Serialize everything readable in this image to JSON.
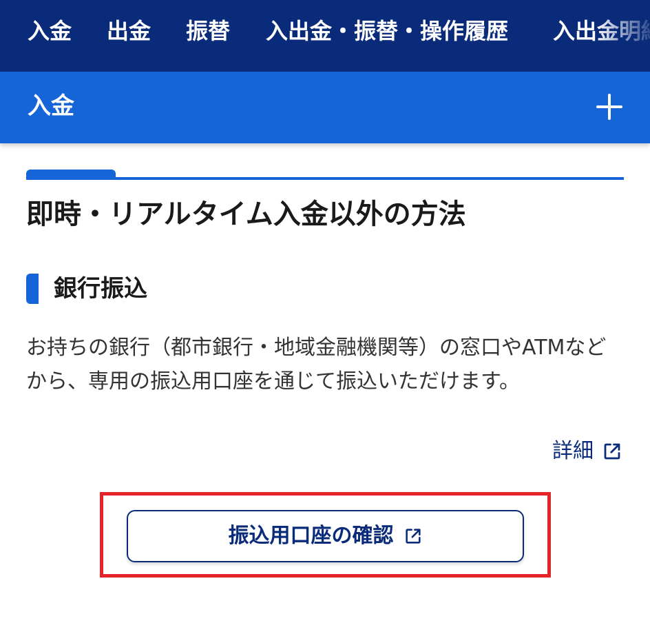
{
  "top_nav": {
    "items": [
      {
        "label": "入金"
      },
      {
        "label": "出金"
      },
      {
        "label": "振替"
      },
      {
        "label": "入出金・振替・操作履歴"
      },
      {
        "label": "入出金明細"
      }
    ]
  },
  "accordion": {
    "title": "入金",
    "toggle_icon": "plus-icon"
  },
  "section": {
    "heading": "即時・リアルタイム入金以外の方法",
    "subsection": {
      "heading": "銀行振込",
      "body": "お持ちの銀行（都市銀行・地域金融機関等）の窓口やATMなどから、専用の振込用口座を通じて振込いただけます。",
      "detail_link_label": "詳細",
      "detail_link_icon": "external-link-icon"
    }
  },
  "confirm_button": {
    "label": "振込用口座の確認",
    "icon": "external-link-icon"
  },
  "colors": {
    "nav_bg": "#0a2a7a",
    "accent_blue": "#1565d8",
    "highlight_red": "#e5252a"
  }
}
